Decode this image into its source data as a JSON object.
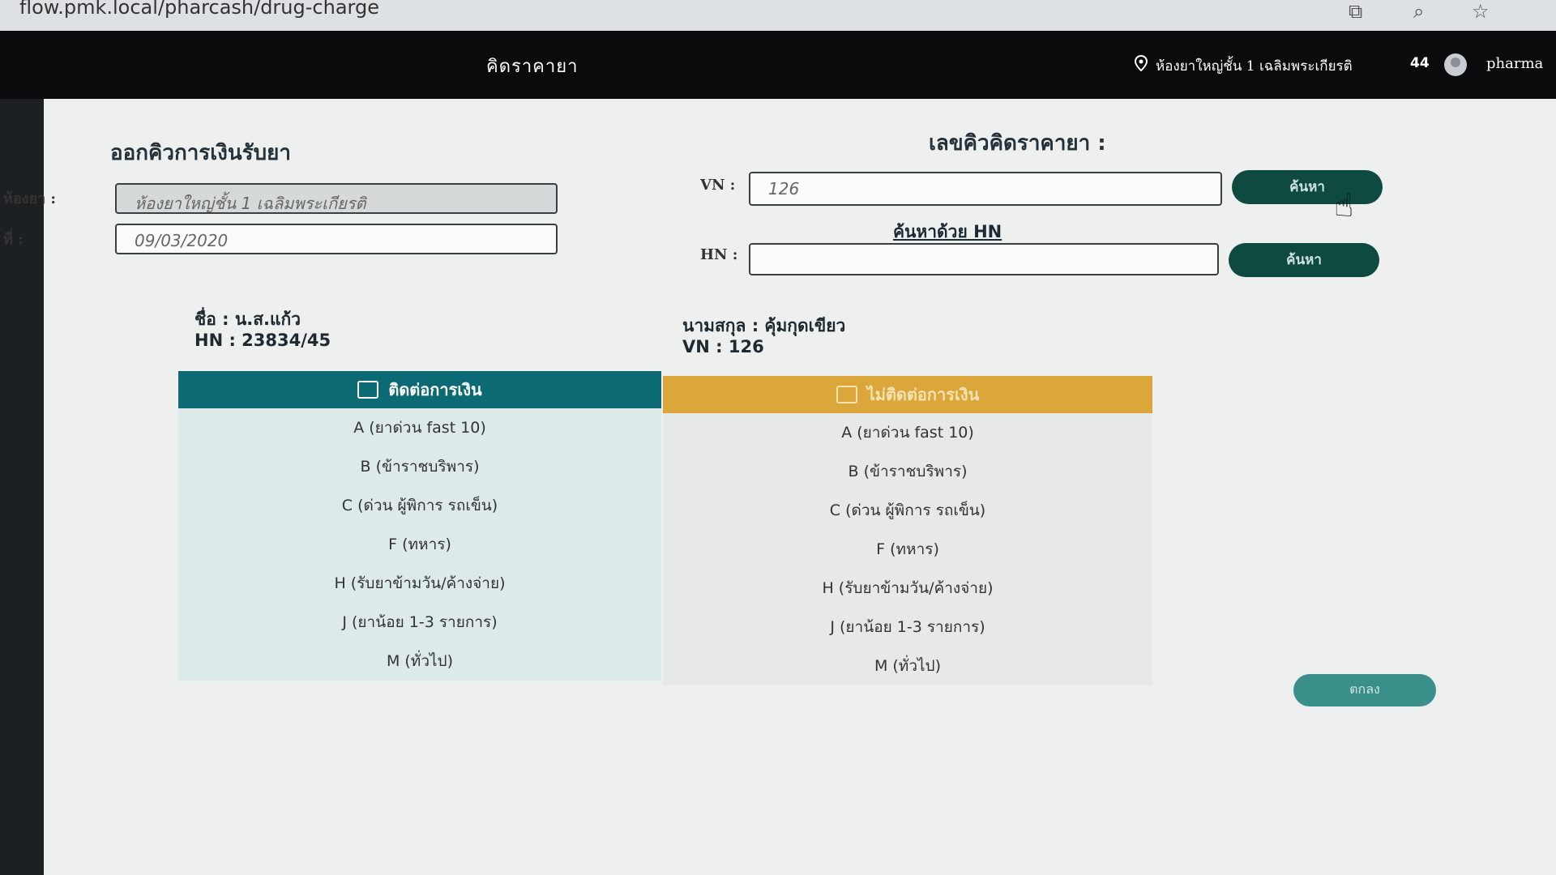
{
  "browser": {
    "url": "flow.pmk.local/pharcash/drug-charge"
  },
  "header": {
    "title": "คิดราคายา",
    "location": "ห้องยาใหญ่ชั้น 1 เฉลิมพระเกียรติ",
    "count": "44",
    "user": "pharma"
  },
  "left_form": {
    "title": "ออกคิวการเงินรับยา",
    "room_label": "ห้องยา :",
    "room_value": "ห้องยาใหญ่ชั้น 1 เฉลิมพระเกียรติ",
    "date_label": "ที่ :",
    "date_value": "09/03/2020"
  },
  "queue": {
    "title": "เลขคิวคิดราคายา :",
    "vn_label": "VN :",
    "vn_value": "126",
    "search_vn_label": "ค้นหา",
    "search_by_hn_link": "ค้นหาด้วย HN",
    "hn_label": "HN :",
    "hn_value": "",
    "search_hn_label": "ค้นหา"
  },
  "patient": {
    "name_label": "ชื่อ : น.ส.แก้ว",
    "hn_line": "HN : 23834/45",
    "surname_label": "นามสกุล : คุ้มกุดเขียว",
    "vn_line": "VN : 126"
  },
  "tabs": {
    "contact_finance": "ติดต่อการเงิน",
    "no_contact_finance": "ไม่ติดต่อการเงิน"
  },
  "queue_types": [
    "A (ยาด่วน fast 10)",
    "B (ข้าราชบริพาร)",
    "C (ด่วน ผู้พิการ รถเข็น)",
    "F (ทหาร)",
    "H (รับยาข้ามวัน/ค้างจ่าย)",
    "J (ยาน้อย 1-3 รายการ)",
    "M (ทั่วไป)"
  ],
  "actions": {
    "confirm_label": "ตกลง"
  },
  "colors": {
    "teal": "#0b6a73",
    "gold": "#dba63a",
    "dark_button": "#0f4a40"
  }
}
